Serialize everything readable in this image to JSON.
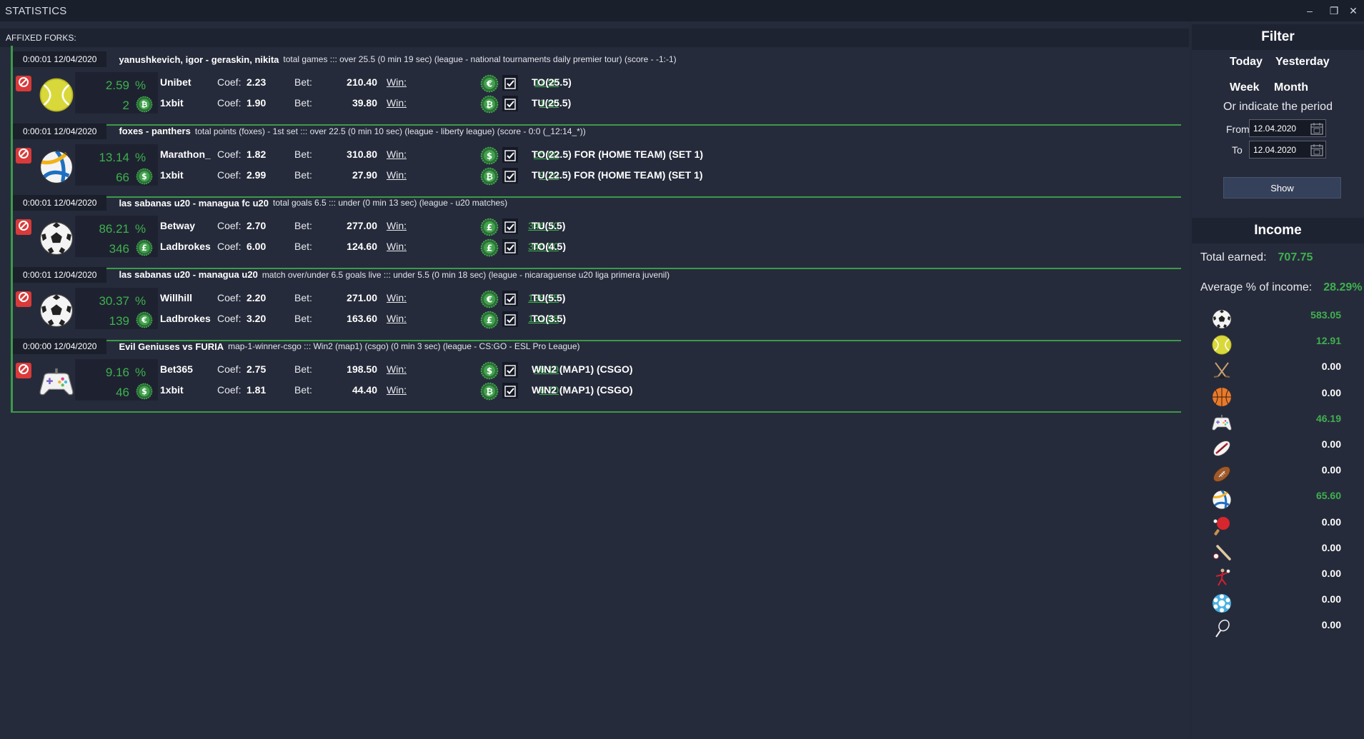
{
  "window": {
    "title": "STATISTICS",
    "minimize": "–",
    "restore": "❐",
    "close": "✕"
  },
  "section_title": "AFFIXED FORKS:",
  "forks": [
    {
      "time": "0:00:01 12/04/2020",
      "match": "yanushkevich, igor - geraskin, nikita",
      "desc": "total games ::: over 25.5 (0 min 19 sec) (league - national tournaments daily premier tour) (score - -1:-1)",
      "sport": "tennis",
      "percent": "2.59",
      "pct_sign": "%",
      "profit": "2",
      "profit_currency": "bitcoin",
      "rows": [
        {
          "bookmaker": "Unibet",
          "coef_label": "Coef:",
          "coef": "2.23",
          "bet_label": "Bet:",
          "bet": "210.40",
          "win_label": "Win:",
          "win": "11.90",
          "currency": "euro",
          "outcome": "TO(25.5)"
        },
        {
          "bookmaker": "1xbit",
          "coef_label": "Coef:",
          "coef": "1.90",
          "bet_label": "Bet:",
          "bet": "39.80",
          "win_label": "Win:",
          "win": "1.90",
          "currency": "bitcoin",
          "outcome": "TU(25.5)"
        }
      ]
    },
    {
      "time": "0:00:01 12/04/2020",
      "match": "foxes - panthers",
      "desc": "total points (foxes) - 1st set ::: over 22.5 (0 min 10 sec) (league - liberty league) (score - 0:0 (_12:14_*))",
      "sport": "volleyball",
      "percent": "13.14",
      "pct_sign": "%",
      "profit": "66",
      "profit_currency": "dollar",
      "rows": [
        {
          "bookmaker": "Marathon_",
          "coef_label": "Coef:",
          "coef": "1.82",
          "bet_label": "Bet:",
          "bet": "310.80",
          "win_label": "Win:",
          "win": "65.60",
          "currency": "dollar",
          "outcome": "TO(22.5) FOR (HOME TEAM) (SET 1)"
        },
        {
          "bookmaker": "1xbit",
          "coef_label": "Coef:",
          "coef": "2.99",
          "bet_label": "Bet:",
          "bet": "27.90",
          "win_label": "Win:",
          "win": "9.70",
          "currency": "bitcoin",
          "outcome": "TU(22.5) FOR (HOME TEAM) (SET 1)"
        }
      ]
    },
    {
      "time": "0:00:01 12/04/2020",
      "match": "las sabanas u20 - managua fc u20",
      "desc": "total goals 6.5 ::: under (0 min 13 sec) (league - u20 matches)",
      "sport": "soccer",
      "percent": "86.21",
      "pct_sign": "%",
      "profit": "346",
      "profit_currency": "pound",
      "rows": [
        {
          "bookmaker": "Betway",
          "coef_label": "Coef:",
          "coef": "2.70",
          "bet_label": "Bet:",
          "bet": "277.00",
          "win_label": "Win:",
          "win": "346.30",
          "currency": "pound",
          "outcome": "TU(5.5)"
        },
        {
          "bookmaker": "Ladbrokes",
          "coef_label": "Coef:",
          "coef": "6.00",
          "bet_label": "Bet:",
          "bet": "124.60",
          "win_label": "Win:",
          "win": "346.00",
          "currency": "pound",
          "outcome": "TO(4.5)"
        }
      ]
    },
    {
      "time": "0:00:01 12/04/2020",
      "match": "las sabanas u20 - managua u20",
      "desc": "match over/under 6.5 goals live ::: under 5.5 (0 min 18 sec) (league - nicaraguense u20 liga primera juvenil)",
      "sport": "soccer",
      "percent": "30.37",
      "pct_sign": "%",
      "profit": "139",
      "profit_currency": "euro",
      "rows": [
        {
          "bookmaker": "Willhill",
          "coef_label": "Coef:",
          "coef": "2.20",
          "bet_label": "Bet:",
          "bet": "271.00",
          "win_label": "Win:",
          "win": "138.95",
          "currency": "euro",
          "outcome": "TU(5.5)"
        },
        {
          "bookmaker": "Ladbrokes",
          "coef_label": "Coef:",
          "coef": "3.20",
          "bet_label": "Bet:",
          "bet": "163.60",
          "win_label": "Win:",
          "win": "121.88",
          "currency": "pound",
          "outcome": "TO(3.5)"
        }
      ]
    },
    {
      "time": "0:00:00 12/04/2020",
      "match": "Evil Geniuses vs FURIA",
      "desc": "map-1-winner-csgo ::: Win2 (map1) (csgo) (0 min 3 sec) (league - CS:GO - ESL Pro League)",
      "sport": "esports",
      "percent": "9.16",
      "pct_sign": "%",
      "profit": "46",
      "profit_currency": "dollar",
      "rows": [
        {
          "bookmaker": "Bet365",
          "coef_label": "Coef:",
          "coef": "2.75",
          "bet_label": "Bet:",
          "bet": "198.50",
          "win_label": "Win:",
          "win": "46.19",
          "currency": "dollar",
          "outcome": "WIN2 (MAP1) (CSGO)"
        },
        {
          "bookmaker": "1xbit",
          "coef_label": "Coef:",
          "coef": "1.81",
          "bet_label": "Bet:",
          "bet": "44.40",
          "win_label": "Win:",
          "win": "6.70",
          "currency": "bitcoin",
          "outcome": "WIN2 (MAP1) (CSGO)"
        }
      ]
    }
  ],
  "filter": {
    "title": "Filter",
    "today": "Today",
    "yesterday": "Yesterday",
    "week": "Week",
    "month": "Month",
    "indicate": "Or indicate the period",
    "from_label": "From",
    "from_value": "12.04.2020",
    "to_label": "To",
    "to_value": "12.04.2020",
    "show": "Show"
  },
  "income": {
    "title": "Income",
    "total_label": "Total earned:",
    "total_value": "707.75",
    "avg_label": "Average % of income:",
    "avg_value": "28.29%",
    "by_sport": [
      {
        "sport": "soccer",
        "value": "583.05",
        "color": "#3fb04f"
      },
      {
        "sport": "tennis",
        "value": "12.91",
        "color": "#3fb04f"
      },
      {
        "sport": "hockey",
        "value": "0.00",
        "color": "#ffffff"
      },
      {
        "sport": "basketball",
        "value": "0.00",
        "color": "#ffffff"
      },
      {
        "sport": "esports",
        "value": "46.19",
        "color": "#3fb04f"
      },
      {
        "sport": "rugby",
        "value": "0.00",
        "color": "#ffffff"
      },
      {
        "sport": "american-football",
        "value": "0.00",
        "color": "#ffffff"
      },
      {
        "sport": "volleyball",
        "value": "65.60",
        "color": "#3fb04f"
      },
      {
        "sport": "table-tennis",
        "value": "0.00",
        "color": "#ffffff"
      },
      {
        "sport": "baseball",
        "value": "0.00",
        "color": "#ffffff"
      },
      {
        "sport": "handball",
        "value": "0.00",
        "color": "#ffffff"
      },
      {
        "sport": "futsal",
        "value": "0.00",
        "color": "#ffffff"
      },
      {
        "sport": "badminton",
        "value": "0.00",
        "color": "#ffffff"
      }
    ]
  },
  "colors": {
    "accent_green": "#3fb04f",
    "ban_red": "#d93a3a",
    "background": "#262b3b",
    "header": "#1e2332"
  }
}
